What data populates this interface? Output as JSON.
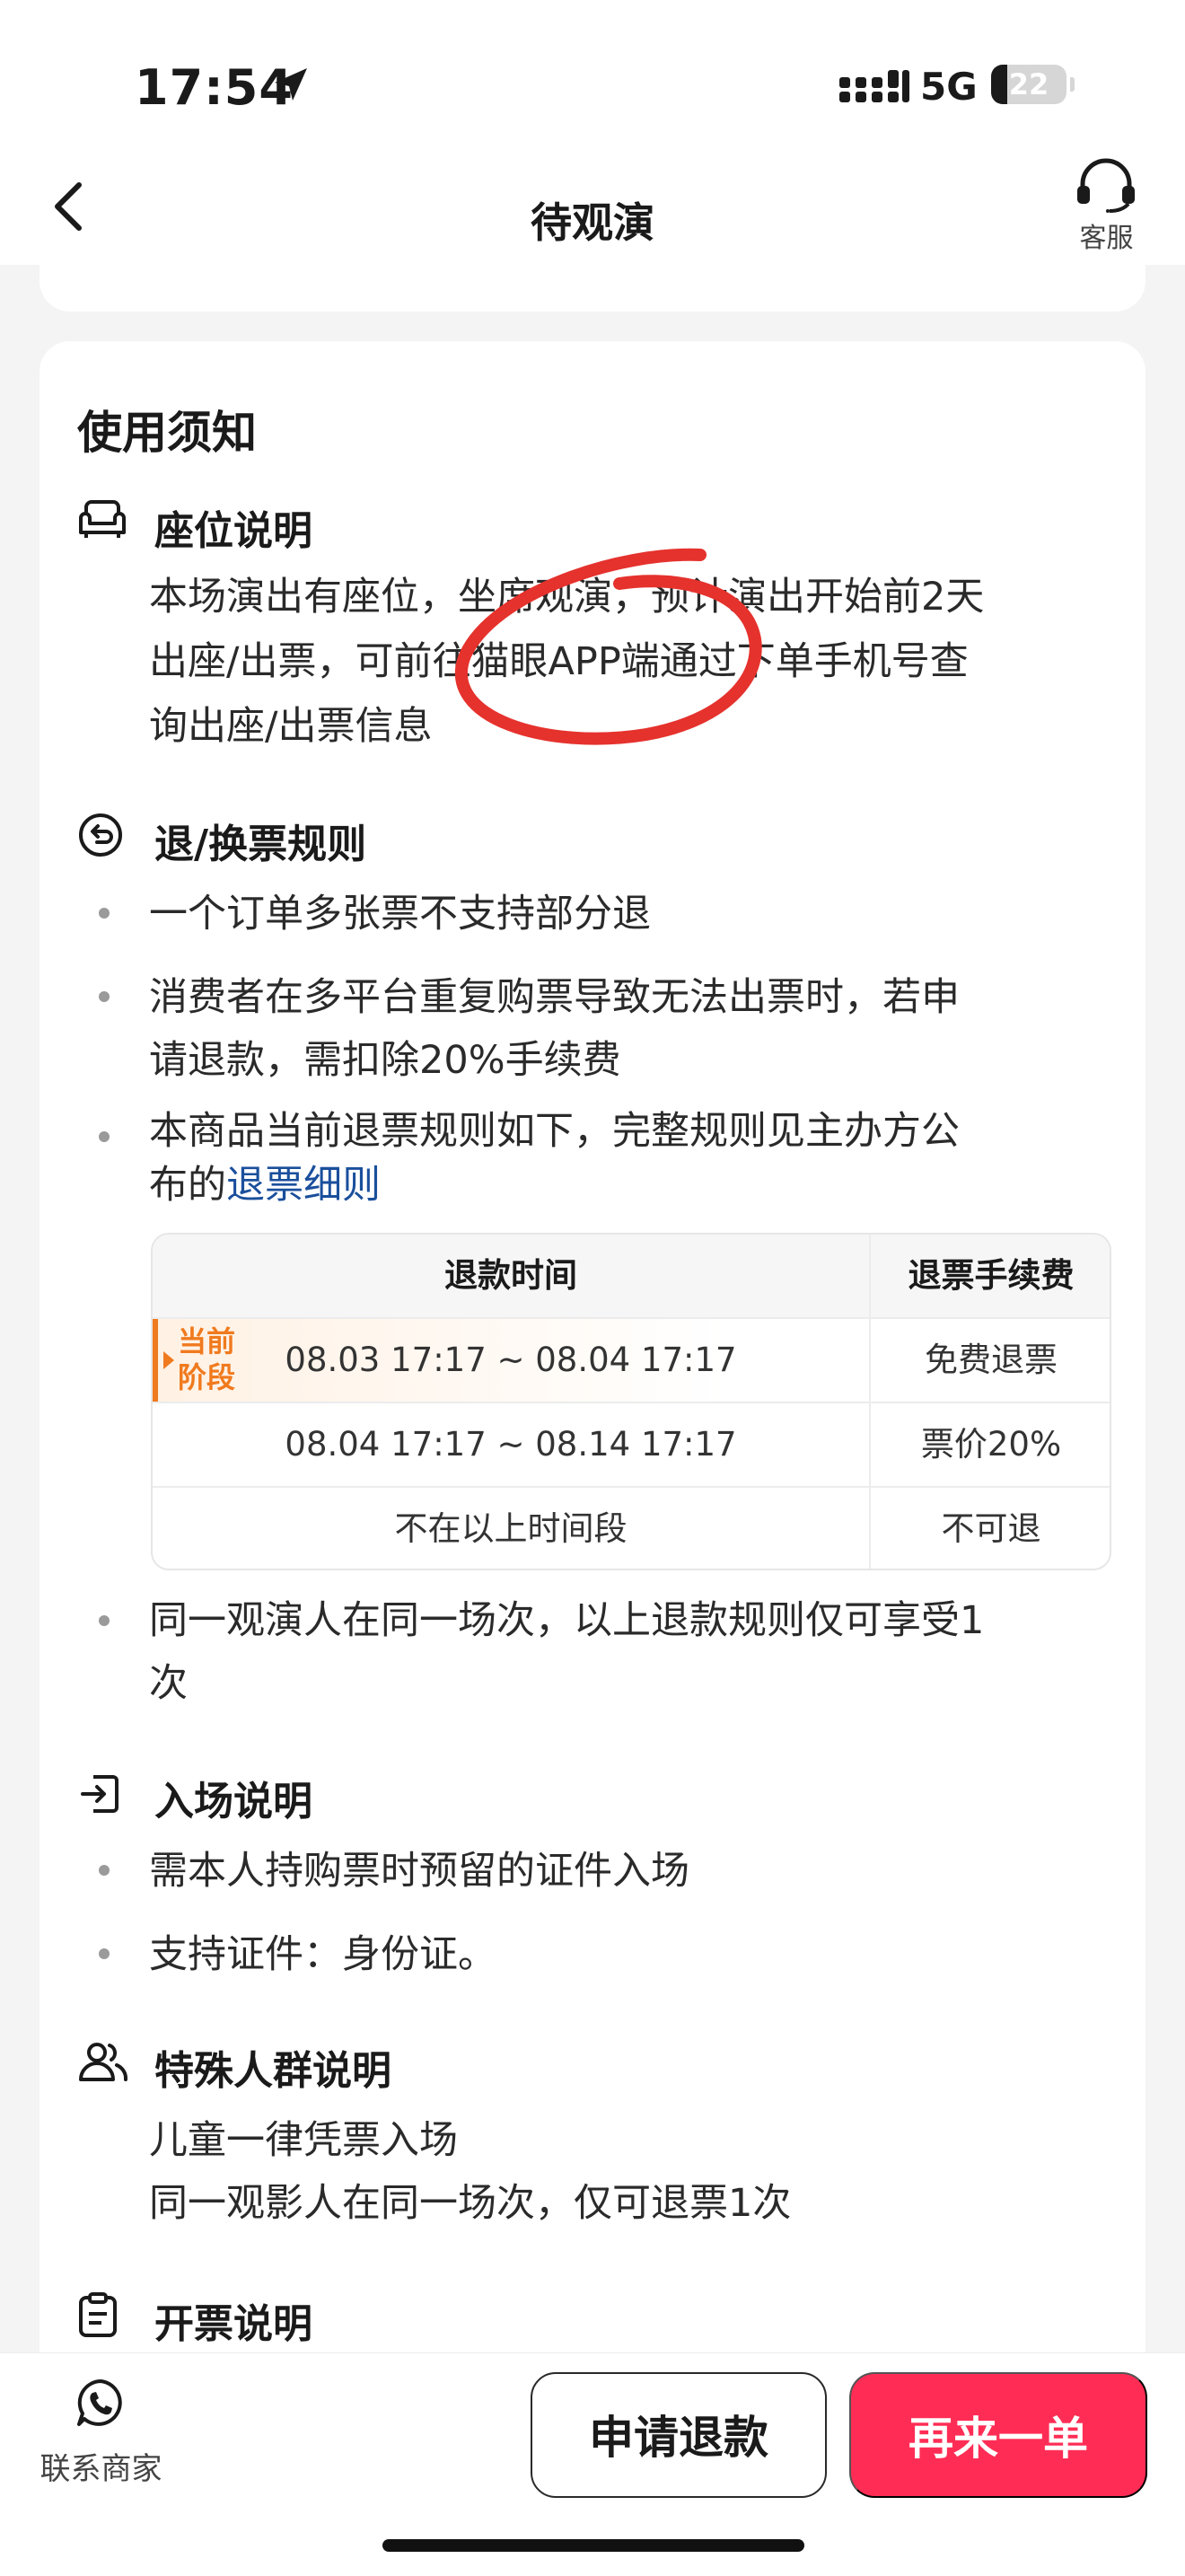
{
  "status_bar": {
    "time": "17:54",
    "network": "5G",
    "battery": "22",
    "battery_level": 0.22
  },
  "nav": {
    "title": "待观演",
    "customer_service": "客服"
  },
  "notice": {
    "title": "使用须知",
    "seat": {
      "title": "座位说明",
      "lines": [
        "本场演出有座位，坐席观演，预计演出开始前2天",
        "出座/出票，可前往猫眼APP端通过下单手机号查",
        "询出座/出票信息"
      ]
    },
    "refund": {
      "title": "退/换票规则",
      "bullet1": "一个订单多张票不支持部分退",
      "bullet2_lines": [
        "消费者在多平台重复购票导致无法出票时，若申",
        "请退款，需扣除20%手续费"
      ],
      "bullet3_line1": "本商品当前退票规则如下，完整规则见主办方公",
      "bullet3_line2_prefix": "布的",
      "bullet3_link": "退票细则",
      "table": {
        "headers": [
          "退款时间",
          "退票手续费"
        ],
        "current_stage_line1": "当前",
        "current_stage_line2": "阶段",
        "rows": [
          {
            "time": "08.03 17:17 ~ 08.04 17:17",
            "fee": "免费退票"
          },
          {
            "time": "08.04 17:17 ~ 08.14 17:17",
            "fee": "票价20%"
          },
          {
            "time": "不在以上时间段",
            "fee": "不可退"
          }
        ]
      },
      "bullet4_lines": [
        "同一观演人在同一场次，以上退款规则仅可享受1",
        "次"
      ]
    },
    "entry": {
      "title": "入场说明",
      "bullets": [
        "需本人持购票时预留的证件入场",
        "支持证件：身份证。"
      ]
    },
    "special": {
      "title": "特殊人群说明",
      "lines": [
        "儿童一律凭票入场",
        "同一观影人在同一场次，仅可退票1次"
      ]
    },
    "invoice": {
      "title": "开票说明"
    }
  },
  "bottom_bar": {
    "contact": "联系商家",
    "refund_button": "申请退款",
    "reorder_button": "再来一单"
  },
  "colors": {
    "accent": "#ff2d55",
    "link": "#1a4f9c",
    "stage": "#f07a1e",
    "annotation": "#e5322d"
  }
}
